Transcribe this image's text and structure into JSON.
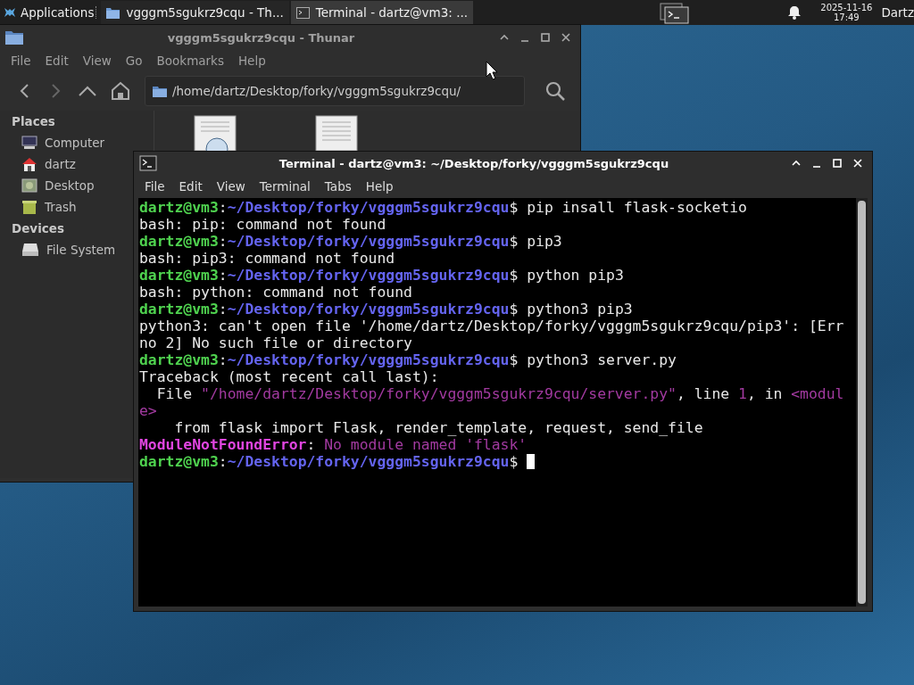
{
  "taskbar": {
    "apps_menu": "Applications",
    "tasks": [
      {
        "title": "vgggm5sgukrz9cqu - Th...",
        "kind": "folder",
        "selected": false
      },
      {
        "title": "Terminal - dartz@vm3: ...",
        "kind": "terminal",
        "selected": true
      }
    ],
    "clock_date": "2025-11-16",
    "clock_time": "17:49",
    "user": "Dartz"
  },
  "file_manager": {
    "title": "vgggm5sgukrz9cqu - Thunar",
    "menu": [
      "File",
      "Edit",
      "View",
      "Go",
      "Bookmarks",
      "Help"
    ],
    "location": "/home/dartz/Desktop/forky/vgggm5sgukrz9cqu/",
    "sidebar": [
      {
        "heading": "Places",
        "items": [
          {
            "label": "Computer",
            "kind": "computer"
          },
          {
            "label": "dartz",
            "kind": "home"
          },
          {
            "label": "Desktop",
            "kind": "desktop"
          },
          {
            "label": "Trash",
            "kind": "trash"
          }
        ]
      },
      {
        "heading": "Devices",
        "items": [
          {
            "label": "File System",
            "kind": "drive"
          }
        ]
      }
    ],
    "files": [
      {
        "kind": "html"
      },
      {
        "kind": "text"
      }
    ]
  },
  "terminal": {
    "title": "Terminal - dartz@vm3: ~/Desktop/forky/vgggm5sgukrz9cqu",
    "menu": [
      "File",
      "Edit",
      "View",
      "Terminal",
      "Tabs",
      "Help"
    ],
    "lines": [
      {
        "segments": [
          {
            "kind": "user",
            "text": "dartz@vm3"
          },
          {
            "kind": "text",
            "text": ":"
          },
          {
            "kind": "path",
            "text": "~/Desktop/forky/vgggm5sgukrz9cqu"
          },
          {
            "kind": "text",
            "text": "$ pip insall flask-socketio"
          }
        ]
      },
      {
        "segments": [
          {
            "kind": "text",
            "text": "bash: pip: command not found"
          }
        ]
      },
      {
        "segments": [
          {
            "kind": "user",
            "text": "dartz@vm3"
          },
          {
            "kind": "text",
            "text": ":"
          },
          {
            "kind": "path",
            "text": "~/Desktop/forky/vgggm5sgukrz9cqu"
          },
          {
            "kind": "text",
            "text": "$ pip3"
          }
        ]
      },
      {
        "segments": [
          {
            "kind": "text",
            "text": "bash: pip3: command not found"
          }
        ]
      },
      {
        "segments": [
          {
            "kind": "user",
            "text": "dartz@vm3"
          },
          {
            "kind": "text",
            "text": ":"
          },
          {
            "kind": "path",
            "text": "~/Desktop/forky/vgggm5sgukrz9cqu"
          },
          {
            "kind": "text",
            "text": "$ python pip3"
          }
        ]
      },
      {
        "segments": [
          {
            "kind": "text",
            "text": "bash: python: command not found"
          }
        ]
      },
      {
        "segments": [
          {
            "kind": "user",
            "text": "dartz@vm3"
          },
          {
            "kind": "text",
            "text": ":"
          },
          {
            "kind": "path",
            "text": "~/Desktop/forky/vgggm5sgukrz9cqu"
          },
          {
            "kind": "text",
            "text": "$ python3 pip3"
          }
        ]
      },
      {
        "segments": [
          {
            "kind": "text",
            "text": "python3: can't open file '/home/dartz/Desktop/forky/vgggm5sgukrz9cqu/pip3': [Err"
          }
        ]
      },
      {
        "segments": [
          {
            "kind": "text",
            "text": "no 2] No such file or directory"
          }
        ]
      },
      {
        "segments": [
          {
            "kind": "user",
            "text": "dartz@vm3"
          },
          {
            "kind": "text",
            "text": ":"
          },
          {
            "kind": "path",
            "text": "~/Desktop/forky/vgggm5sgukrz9cqu"
          },
          {
            "kind": "text",
            "text": "$ python3 server.py"
          }
        ]
      },
      {
        "segments": [
          {
            "kind": "text",
            "text": "Traceback (most recent call last):"
          }
        ]
      },
      {
        "segments": [
          {
            "kind": "text",
            "text": "  File "
          },
          {
            "kind": "string",
            "text": "\"/home/dartz/Desktop/forky/vgggm5sgukrz9cqu/server.py\""
          },
          {
            "kind": "text",
            "text": ", line "
          },
          {
            "kind": "string",
            "text": "1"
          },
          {
            "kind": "text",
            "text": ", in "
          },
          {
            "kind": "string",
            "text": "<modul"
          }
        ]
      },
      {
        "segments": [
          {
            "kind": "string",
            "text": "e>"
          }
        ]
      },
      {
        "segments": [
          {
            "kind": "text",
            "text": "    from flask import Flask, render_template, request, send_file"
          }
        ]
      },
      {
        "segments": [
          {
            "kind": "error",
            "text": "ModuleNotFoundError"
          },
          {
            "kind": "text",
            "text": ": "
          },
          {
            "kind": "string",
            "text": "No module named 'flask'"
          }
        ]
      },
      {
        "segments": [
          {
            "kind": "user",
            "text": "dartz@vm3"
          },
          {
            "kind": "text",
            "text": ":"
          },
          {
            "kind": "path",
            "text": "~/Desktop/forky/vgggm5sgukrz9cqu"
          },
          {
            "kind": "text",
            "text": "$ "
          }
        ],
        "cursor": true
      }
    ]
  }
}
